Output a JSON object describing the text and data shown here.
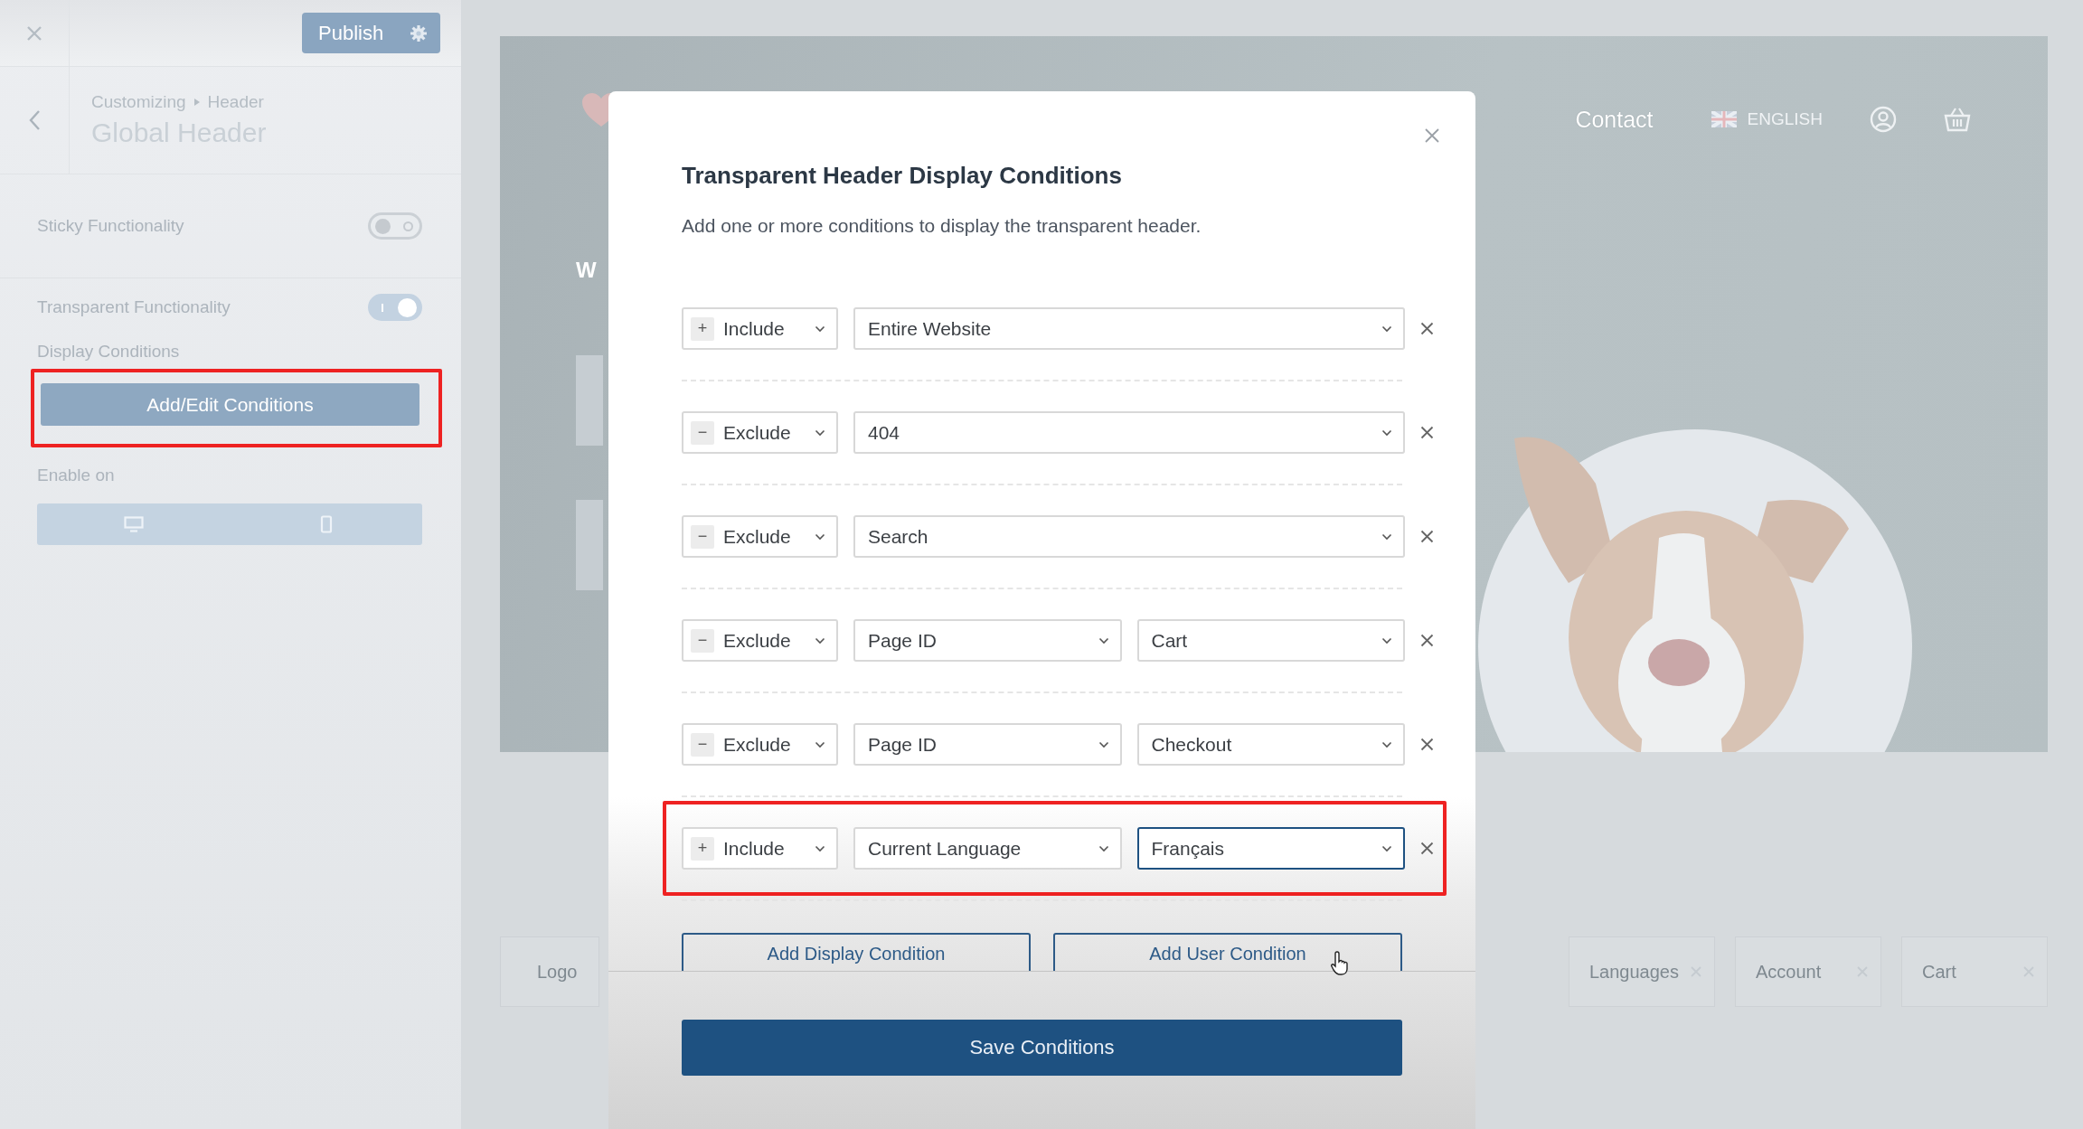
{
  "sidebar": {
    "publish_button": "Publish",
    "breadcrumb": [
      "Customizing",
      "Header"
    ],
    "title": "Global Header",
    "toggles": [
      {
        "label": "Sticky Functionality",
        "on": false
      },
      {
        "label": "Transparent Functionality",
        "on": true
      }
    ],
    "display_conditions": {
      "label": "Display Conditions",
      "button": "Add/Edit Conditions",
      "highlighted": true
    },
    "enable_on": {
      "label": "Enable on",
      "devices": [
        {
          "kind": "desktop"
        },
        {
          "kind": "mobile"
        }
      ]
    }
  },
  "preview": {
    "nav_link": "Contact",
    "language": "ENGLISH",
    "hero_texts": [
      "W"
    ],
    "builder_items": [
      {
        "label": "Logo",
        "removable": false
      },
      {
        "label": "Languages",
        "removable": true
      },
      {
        "label": "Account",
        "removable": true
      },
      {
        "label": "Cart",
        "removable": true
      }
    ]
  },
  "modal": {
    "title": "Transparent Header Display Conditions",
    "description": "Add one or more conditions to display the transparent header.",
    "conditions": [
      {
        "sign": "+",
        "mode": "Include",
        "rule": "Entire Website",
        "highlighted": false,
        "focused": false
      },
      {
        "sign": "−",
        "mode": "Exclude",
        "rule": "404",
        "highlighted": false,
        "focused": false
      },
      {
        "sign": "−",
        "mode": "Exclude",
        "rule": "Search",
        "highlighted": false,
        "focused": false
      },
      {
        "sign": "−",
        "mode": "Exclude",
        "rule": "Page ID",
        "value": "Cart",
        "highlighted": false,
        "focused": false
      },
      {
        "sign": "−",
        "mode": "Exclude",
        "rule": "Page ID",
        "value": "Checkout",
        "highlighted": false,
        "focused": false
      },
      {
        "sign": "+",
        "mode": "Include",
        "rule": "Current Language",
        "value": "Français",
        "highlighted": true,
        "focused": true
      }
    ],
    "add_buttons": [
      "Add Display Condition",
      "Add User Condition"
    ],
    "save_button": "Save Conditions"
  }
}
